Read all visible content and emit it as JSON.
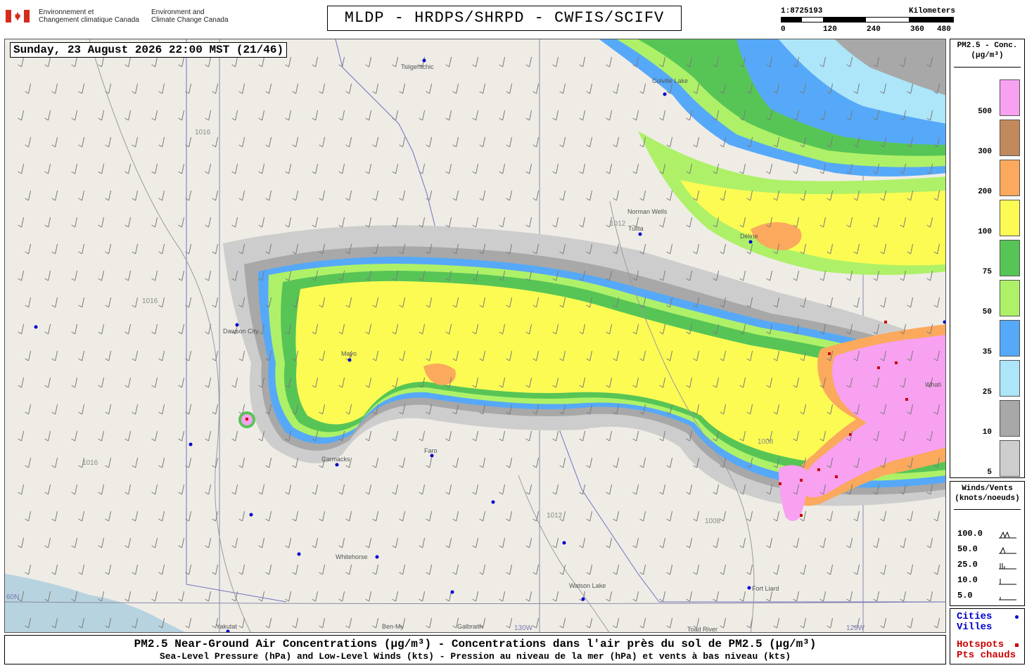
{
  "header": {
    "org_fr_line1": "Environnement et",
    "org_fr_line2": "Changement climatique Canada",
    "org_en_line1": "Environment and",
    "org_en_line2": "Climate Change Canada",
    "title": "MLDP - HRDPS/SHRPD - CWFIS/SCIFV"
  },
  "scale": {
    "ratio": "1:8725193",
    "unit": "Kilometers",
    "ticks": [
      "0",
      "120",
      "240",
      "360",
      "480"
    ]
  },
  "map": {
    "timestamp": "Sunday, 23 August 2026 22:00 MST (21/46)",
    "places": [
      {
        "name": "Tsiigehtchic"
      },
      {
        "name": "Colville Lake"
      },
      {
        "name": "Norman Wells"
      },
      {
        "name": "Tulita"
      },
      {
        "name": "Déline"
      },
      {
        "name": "Dawson City"
      },
      {
        "name": "Mayo"
      },
      {
        "name": "Carmacks"
      },
      {
        "name": "Faro"
      },
      {
        "name": "Whitehorse"
      },
      {
        "name": "Watson Lake"
      },
      {
        "name": "Fort Liard"
      },
      {
        "name": "Yakutat"
      },
      {
        "name": "Ben-My"
      },
      {
        "name": "Galbraith"
      },
      {
        "name": "Toad River"
      },
      {
        "name": "Whati"
      }
    ],
    "isobar_labels": [
      "1016",
      "1012",
      "1008"
    ],
    "grid_labels": [
      "60N",
      "130W",
      "120W"
    ]
  },
  "legend_pm": {
    "title_line1": "PM2.5 - Conc.",
    "title_line2": "(µg/m³)",
    "bins": [
      {
        "label": "500",
        "color": "#f7a1f0"
      },
      {
        "label": "300",
        "color": "#c1895c"
      },
      {
        "label": "200",
        "color": "#fba95c"
      },
      {
        "label": "100",
        "color": "#fbfb54"
      },
      {
        "label": "75",
        "color": "#57c556"
      },
      {
        "label": "50",
        "color": "#aef168"
      },
      {
        "label": "35",
        "color": "#56a9f8"
      },
      {
        "label": "25",
        "color": "#ade5f9"
      },
      {
        "label": "10",
        "color": "#a8a8a8"
      },
      {
        "label": "5",
        "color": "#cdcdcd"
      }
    ]
  },
  "legend_wind": {
    "title_line1": "Winds/Vents",
    "title_line2": "(knots/noeuds)",
    "rows": [
      {
        "label": "100.0"
      },
      {
        "label": "50.0"
      },
      {
        "label": "25.0"
      },
      {
        "label": "10.0"
      },
      {
        "label": "5.0"
      }
    ]
  },
  "legend_points": {
    "cities_line1": "Cities",
    "cities_line2": "Villes",
    "hotspots_line1": "Hotspots",
    "hotspots_line2": "Pts chauds",
    "cities_color": "#0000cc",
    "hotspots_color": "#cc0000"
  },
  "footer": {
    "line1": "PM2.5 Near-Ground Air Concentrations (µg/m³) - Concentrations dans l'air près du sol de PM2.5 (µg/m³)",
    "line2": "Sea-Level Pressure (hPa) and Low-Level Winds (kts) - Pression au niveau de la mer (hPa) et vents à bas niveau (kts)"
  }
}
